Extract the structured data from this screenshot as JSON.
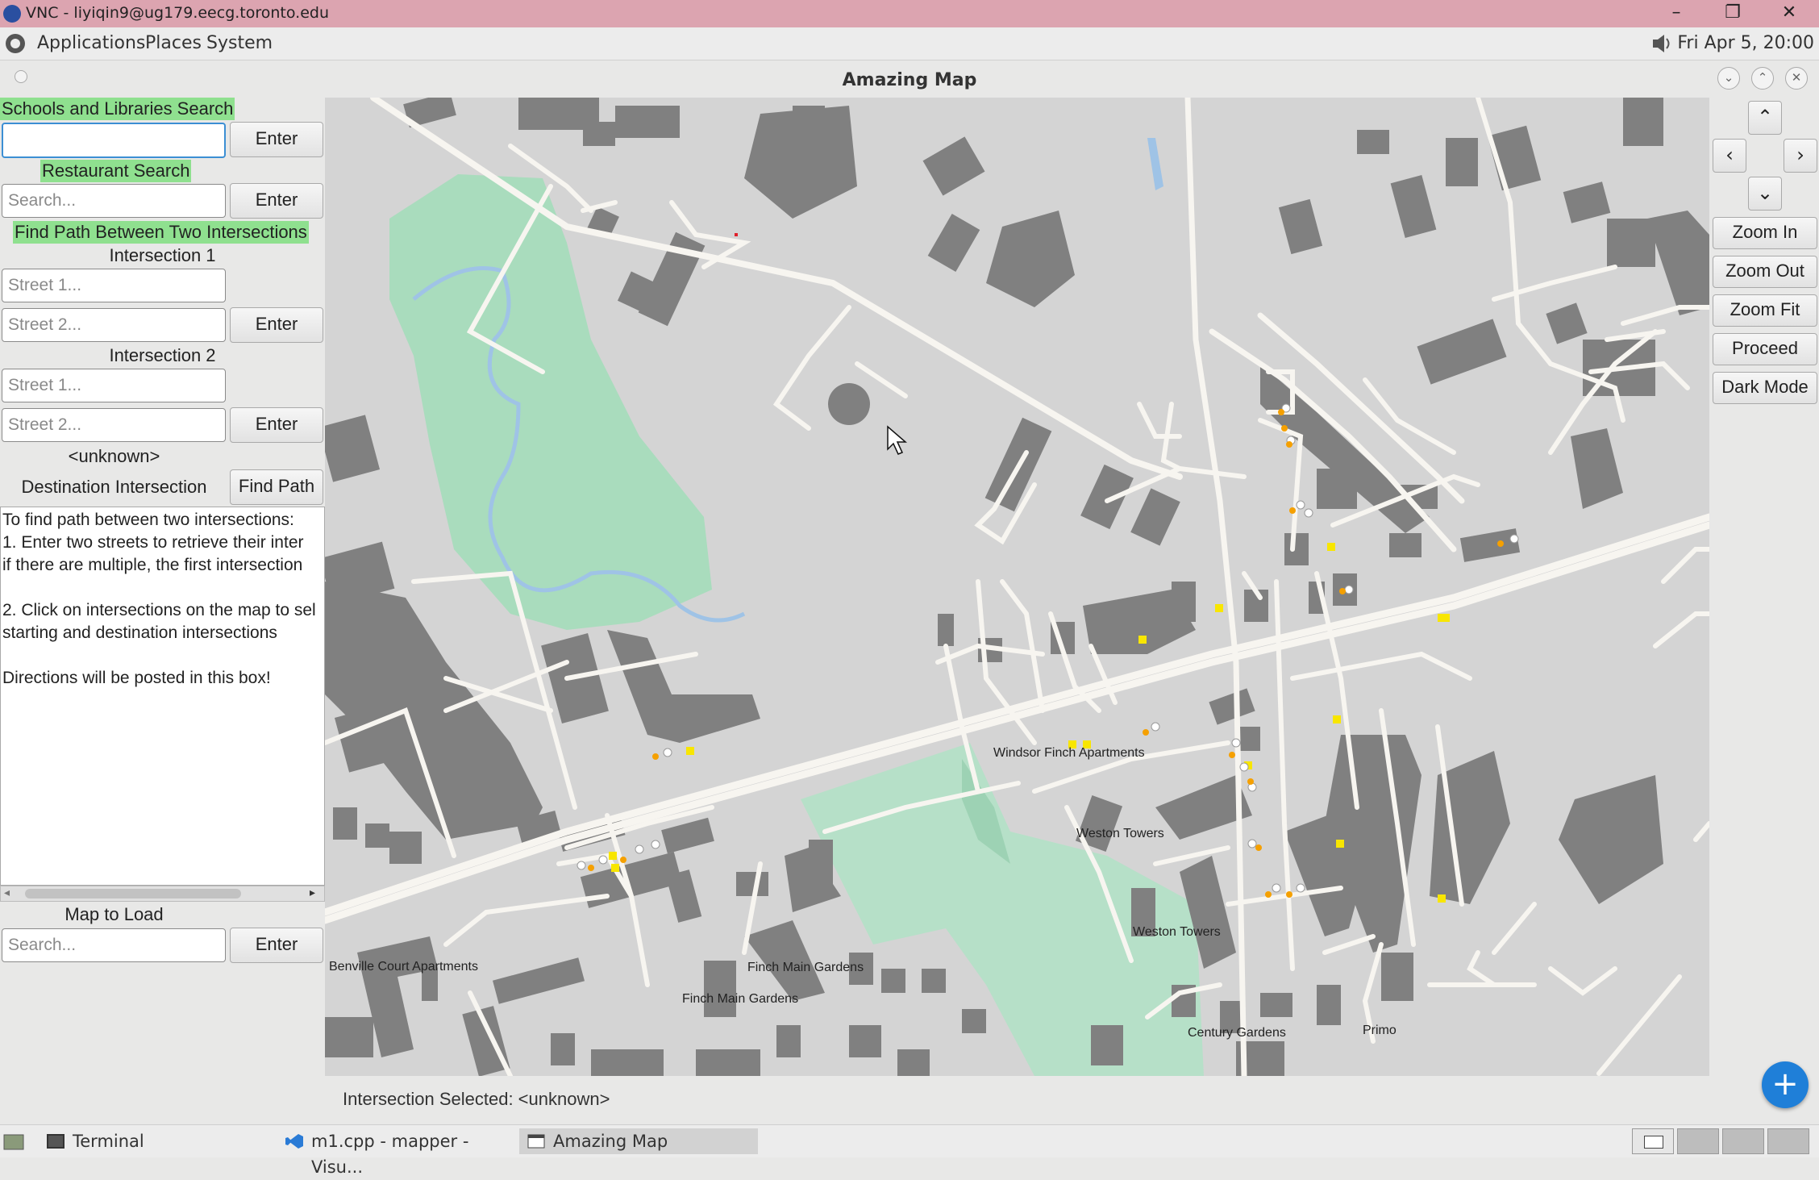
{
  "vnc": {
    "title": "VNC - liyiqin9@ug179.eecg.toronto.edu",
    "minimize": "–",
    "restore": "❐",
    "close": "✕"
  },
  "panel": {
    "menus": [
      "Applications",
      "Places",
      "System"
    ],
    "clock": "Fri Apr  5, 20:00"
  },
  "window": {
    "title": "Amazing Map"
  },
  "left": {
    "schools_header": "Schools and Libraries Search",
    "schools_value": "",
    "enter": "Enter",
    "restaurant_header": "Restaurant Search",
    "search_placeholder": "Search...",
    "path_header": "Find Path Between Two Intersections",
    "intersection1": "Intersection 1",
    "intersection2": "Intersection 2",
    "street1_placeholder": "Street 1...",
    "street2_placeholder": "Street 2...",
    "unknown": "<unknown>",
    "destination": "Destination Intersection",
    "find_path": "Find Path",
    "directions": "To find path between two intersections:\n1. Enter two streets to retrieve their inter\nif there are multiple, the first intersection\n\n2. Click on intersections on the map to sel\nstarting and destination intersections\n\nDirections will be posted in this box!",
    "map_to_load": "Map to Load"
  },
  "right": {
    "up": "⌃",
    "left": "‹",
    "right": "›",
    "down": "⌄",
    "zoom_in": "Zoom In",
    "zoom_out": "Zoom Out",
    "zoom_fit": "Zoom Fit",
    "proceed": "Proceed",
    "dark_mode": "Dark Mode"
  },
  "map": {
    "labels": [
      "Windsor Finch Apartments",
      "Weston Towers",
      "Weston Towers",
      "Benville Court Apartments",
      "Finch Main Gardens",
      "Finch Main Gardens",
      "Century Gardens",
      "Primo"
    ],
    "colors": {
      "land": "#d4d4d4",
      "road": "#f7f5f0",
      "building": "#808080",
      "park": "#a9dcbd",
      "water": "#9fc3e6",
      "poi_yellow": "#f8e600",
      "poi_orange": "#f5a000"
    }
  },
  "status": {
    "text": "Intersection Selected: <unknown>",
    "fab": "+"
  },
  "taskbar": {
    "items": [
      "Terminal",
      "m1.cpp - mapper - Visu...",
      "Amazing Map"
    ]
  }
}
